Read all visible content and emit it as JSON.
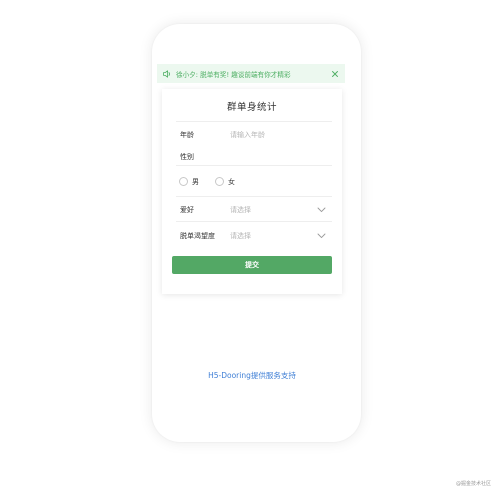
{
  "notice": {
    "text": "徐小夕: 脱单有奖! 趣谈前端有你才精彩",
    "icon": "speaker-icon",
    "close_icon": "close-icon"
  },
  "form": {
    "title": "群单身统计",
    "age": {
      "label": "年龄",
      "placeholder": "请输入年龄"
    },
    "gender": {
      "label": "性别",
      "options": [
        "男",
        "女"
      ]
    },
    "hobby": {
      "label": "爱好",
      "placeholder": "请选择"
    },
    "desire": {
      "label": "脱单渴望度",
      "placeholder": "请选择"
    },
    "submit_label": "提交"
  },
  "footer": {
    "support_text": "H5-Dooring提供服务支持"
  },
  "watermark": "@掘金技术社区",
  "colors": {
    "accent": "#53a865",
    "notice_bg": "#ecf8ef",
    "notice_text": "#4cae62",
    "link": "#3f7fd6"
  }
}
